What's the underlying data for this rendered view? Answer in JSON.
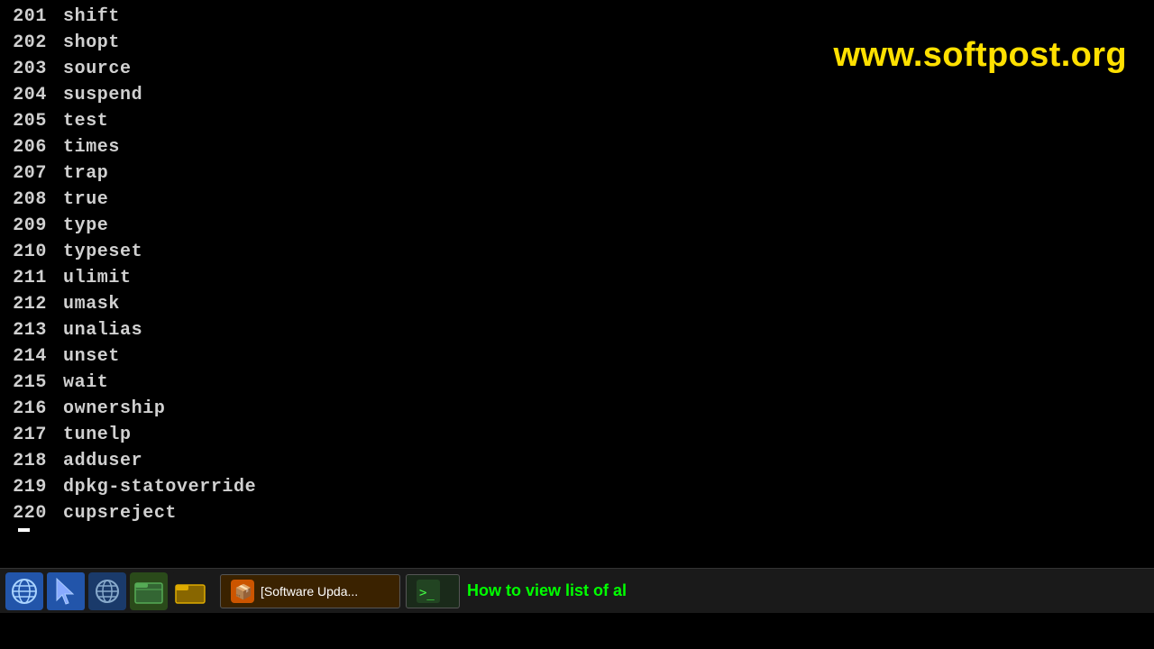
{
  "watermark": "www.softpost.org",
  "taskbar_tip": "How to view list of al",
  "taskbar_app_label": "[Software Upda...",
  "commands": [
    {
      "num": "201",
      "cmd": "shift"
    },
    {
      "num": "202",
      "cmd": "shopt"
    },
    {
      "num": "203",
      "cmd": "source"
    },
    {
      "num": "204",
      "cmd": "suspend"
    },
    {
      "num": "205",
      "cmd": "test"
    },
    {
      "num": "206",
      "cmd": "times"
    },
    {
      "num": "207",
      "cmd": "trap"
    },
    {
      "num": "208",
      "cmd": "true"
    },
    {
      "num": "209",
      "cmd": "type"
    },
    {
      "num": "210",
      "cmd": "typeset"
    },
    {
      "num": "211",
      "cmd": "ulimit"
    },
    {
      "num": "212",
      "cmd": "umask"
    },
    {
      "num": "213",
      "cmd": "unalias"
    },
    {
      "num": "214",
      "cmd": "unset"
    },
    {
      "num": "215",
      "cmd": "wait"
    },
    {
      "num": "216",
      "cmd": "ownership"
    },
    {
      "num": "217",
      "cmd": "tunelp"
    },
    {
      "num": "218",
      "cmd": "adduser"
    },
    {
      "num": "219",
      "cmd": "dpkg-statoverride"
    },
    {
      "num": "220",
      "cmd": "cupsreject"
    }
  ]
}
